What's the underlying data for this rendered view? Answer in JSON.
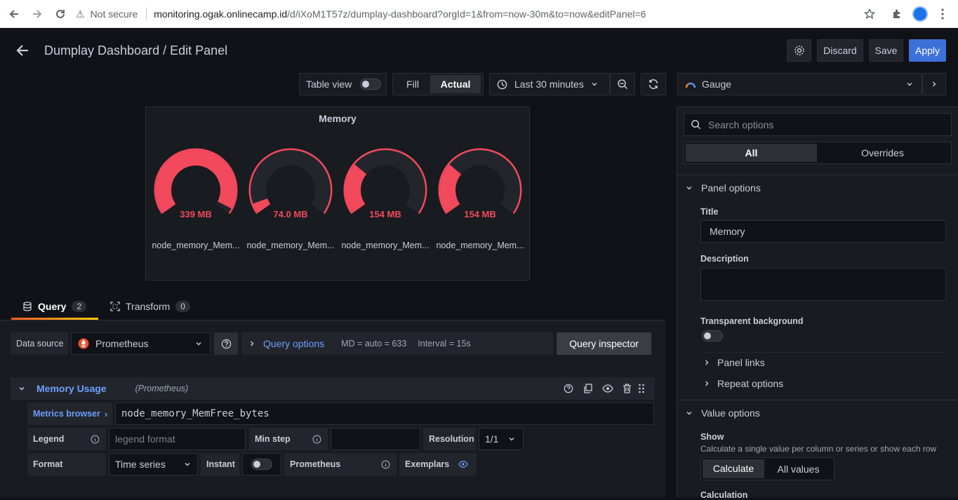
{
  "browser": {
    "not_secure": "Not secure",
    "url_host": "monitoring.ogak.onlinecamp.id",
    "url_path": "/d/iXoM1T57z/dumplay-dashboard?orgId=1&from=now-30m&to=now&editPanel=6"
  },
  "header": {
    "title": "Dumplay Dashboard / Edit Panel",
    "discard": "Discard",
    "save": "Save",
    "apply": "Apply"
  },
  "toolbar": {
    "table_view": "Table view",
    "fill": "Fill",
    "actual": "Actual",
    "time_range": "Last 30 minutes",
    "visualization": "Gauge"
  },
  "panel": {
    "title": "Memory",
    "gauges": [
      {
        "value": "339 MB",
        "name": "node_memory_Mem...",
        "fraction": 0.97
      },
      {
        "value": "74.0 MB",
        "name": "node_memory_Mem...",
        "fraction": 0.06
      },
      {
        "value": "154 MB",
        "name": "node_memory_Mem...",
        "fraction": 0.3
      },
      {
        "value": "154 MB",
        "name": "node_memory_Mem...",
        "fraction": 0.3
      }
    ],
    "gauge_color": "#f2495c"
  },
  "query_tabs": {
    "query": "Query",
    "query_count": "2",
    "transform": "Transform",
    "transform_count": "0"
  },
  "query_row": {
    "datasource_label": "Data source",
    "datasource": "Prometheus",
    "query_options": "Query options",
    "md": "MD = auto = 633",
    "interval": "Interval = 15s",
    "inspector": "Query inspector"
  },
  "query": {
    "name": "Memory Usage",
    "source": "(Prometheus)",
    "metrics_browser": "Metrics browser",
    "expr": "node_memory_MemFree_bytes",
    "legend_label": "Legend",
    "legend_placeholder": "legend format",
    "min_step": "Min step",
    "resolution_label": "Resolution",
    "resolution": "1/1",
    "format_label": "Format",
    "format": "Time series",
    "instant": "Instant",
    "prometheus": "Prometheus",
    "exemplars": "Exemplars"
  },
  "options": {
    "search_placeholder": "Search options",
    "tab_all": "All",
    "tab_overrides": "Overrides",
    "panel_options": "Panel options",
    "title_label": "Title",
    "title_value": "Memory",
    "description_label": "Description",
    "transparent_label": "Transparent background",
    "panel_links": "Panel links",
    "repeat_options": "Repeat options",
    "value_options": "Value options",
    "show_label": "Show",
    "show_desc": "Calculate a single value per column or series or show each row",
    "calculate": "Calculate",
    "all_values": "All values",
    "calculation_label": "Calculation"
  },
  "colors": {
    "accent": "#3d71d9",
    "link": "#6e9fff",
    "orange": "#eb7b18"
  }
}
